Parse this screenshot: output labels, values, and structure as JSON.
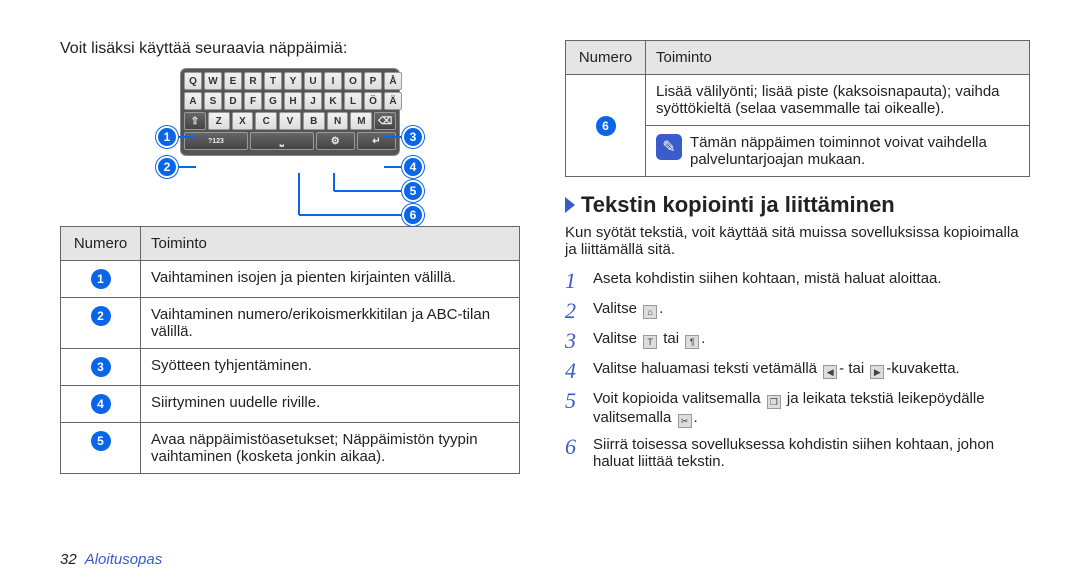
{
  "left": {
    "intro": "Voit lisäksi käyttää seuraavia näppäimiä:",
    "kbd_rows": [
      [
        "Q",
        "W",
        "E",
        "R",
        "T",
        "Y",
        "U",
        "I",
        "O",
        "P",
        "Å"
      ],
      [
        "A",
        "S",
        "D",
        "F",
        "G",
        "H",
        "J",
        "K",
        "L",
        "Ö",
        "Ä"
      ],
      [
        "Z",
        "X",
        "C",
        "V",
        "B",
        "N",
        "M"
      ]
    ],
    "sym_key": "?123",
    "callouts": [
      "1",
      "2",
      "3",
      "4",
      "5",
      "6"
    ],
    "table": {
      "head": {
        "num": "Numero",
        "func": "Toiminto"
      },
      "rows": [
        {
          "n": "1",
          "text": "Vaihtaminen isojen ja pienten kirjainten välillä."
        },
        {
          "n": "2",
          "text": "Vaihtaminen numero/erikoismerkkitilan ja ABC-tilan välillä."
        },
        {
          "n": "3",
          "text": "Syötteen tyhjentäminen."
        },
        {
          "n": "4",
          "text": "Siirtyminen uudelle riville."
        },
        {
          "n": "5",
          "text": "Avaa näppäimistöasetukset; Näppäimistön tyypin vaihtaminen (kosketa jonkin aikaa)."
        }
      ]
    }
  },
  "right": {
    "table": {
      "head": {
        "num": "Numero",
        "func": "Toiminto"
      },
      "row6": {
        "n": "6",
        "text": "Lisää välilyönti; lisää piste (kaksoisnapauta); vaihda syöttökieltä (selaa vasemmalle tai oikealle)."
      },
      "note": "Tämän näppäimen toiminnot voivat vaihdella palveluntarjoajan mukaan."
    },
    "heading": "Tekstin kopiointi ja liittäminen",
    "sub": "Kun syötät tekstiä, voit käyttää sitä muissa sovelluksissa kopioimalla ja liittämällä sitä.",
    "steps": [
      "Aseta kohdistin siihen kohtaan, mistä haluat aloittaa.",
      "Valitse ",
      "Valitse ",
      "Valitse haluamasi teksti vetämällä ",
      "Voit kopioida valitsemalla ",
      "Siirrä toisessa sovelluksessa kohdistin siihen kohtaan, johon haluat liittää tekstin."
    ],
    "step2_suffix": ".",
    "step3_mid": " tai ",
    "step3_suffix": ".",
    "step4_mid": "- tai ",
    "step4_suffix": "-kuvaketta.",
    "step5_mid": " ja leikata tekstiä leikepöydälle valitsemalla ",
    "step5_suffix": "."
  },
  "footer": {
    "page": "32",
    "text": "Aloitusopas"
  }
}
